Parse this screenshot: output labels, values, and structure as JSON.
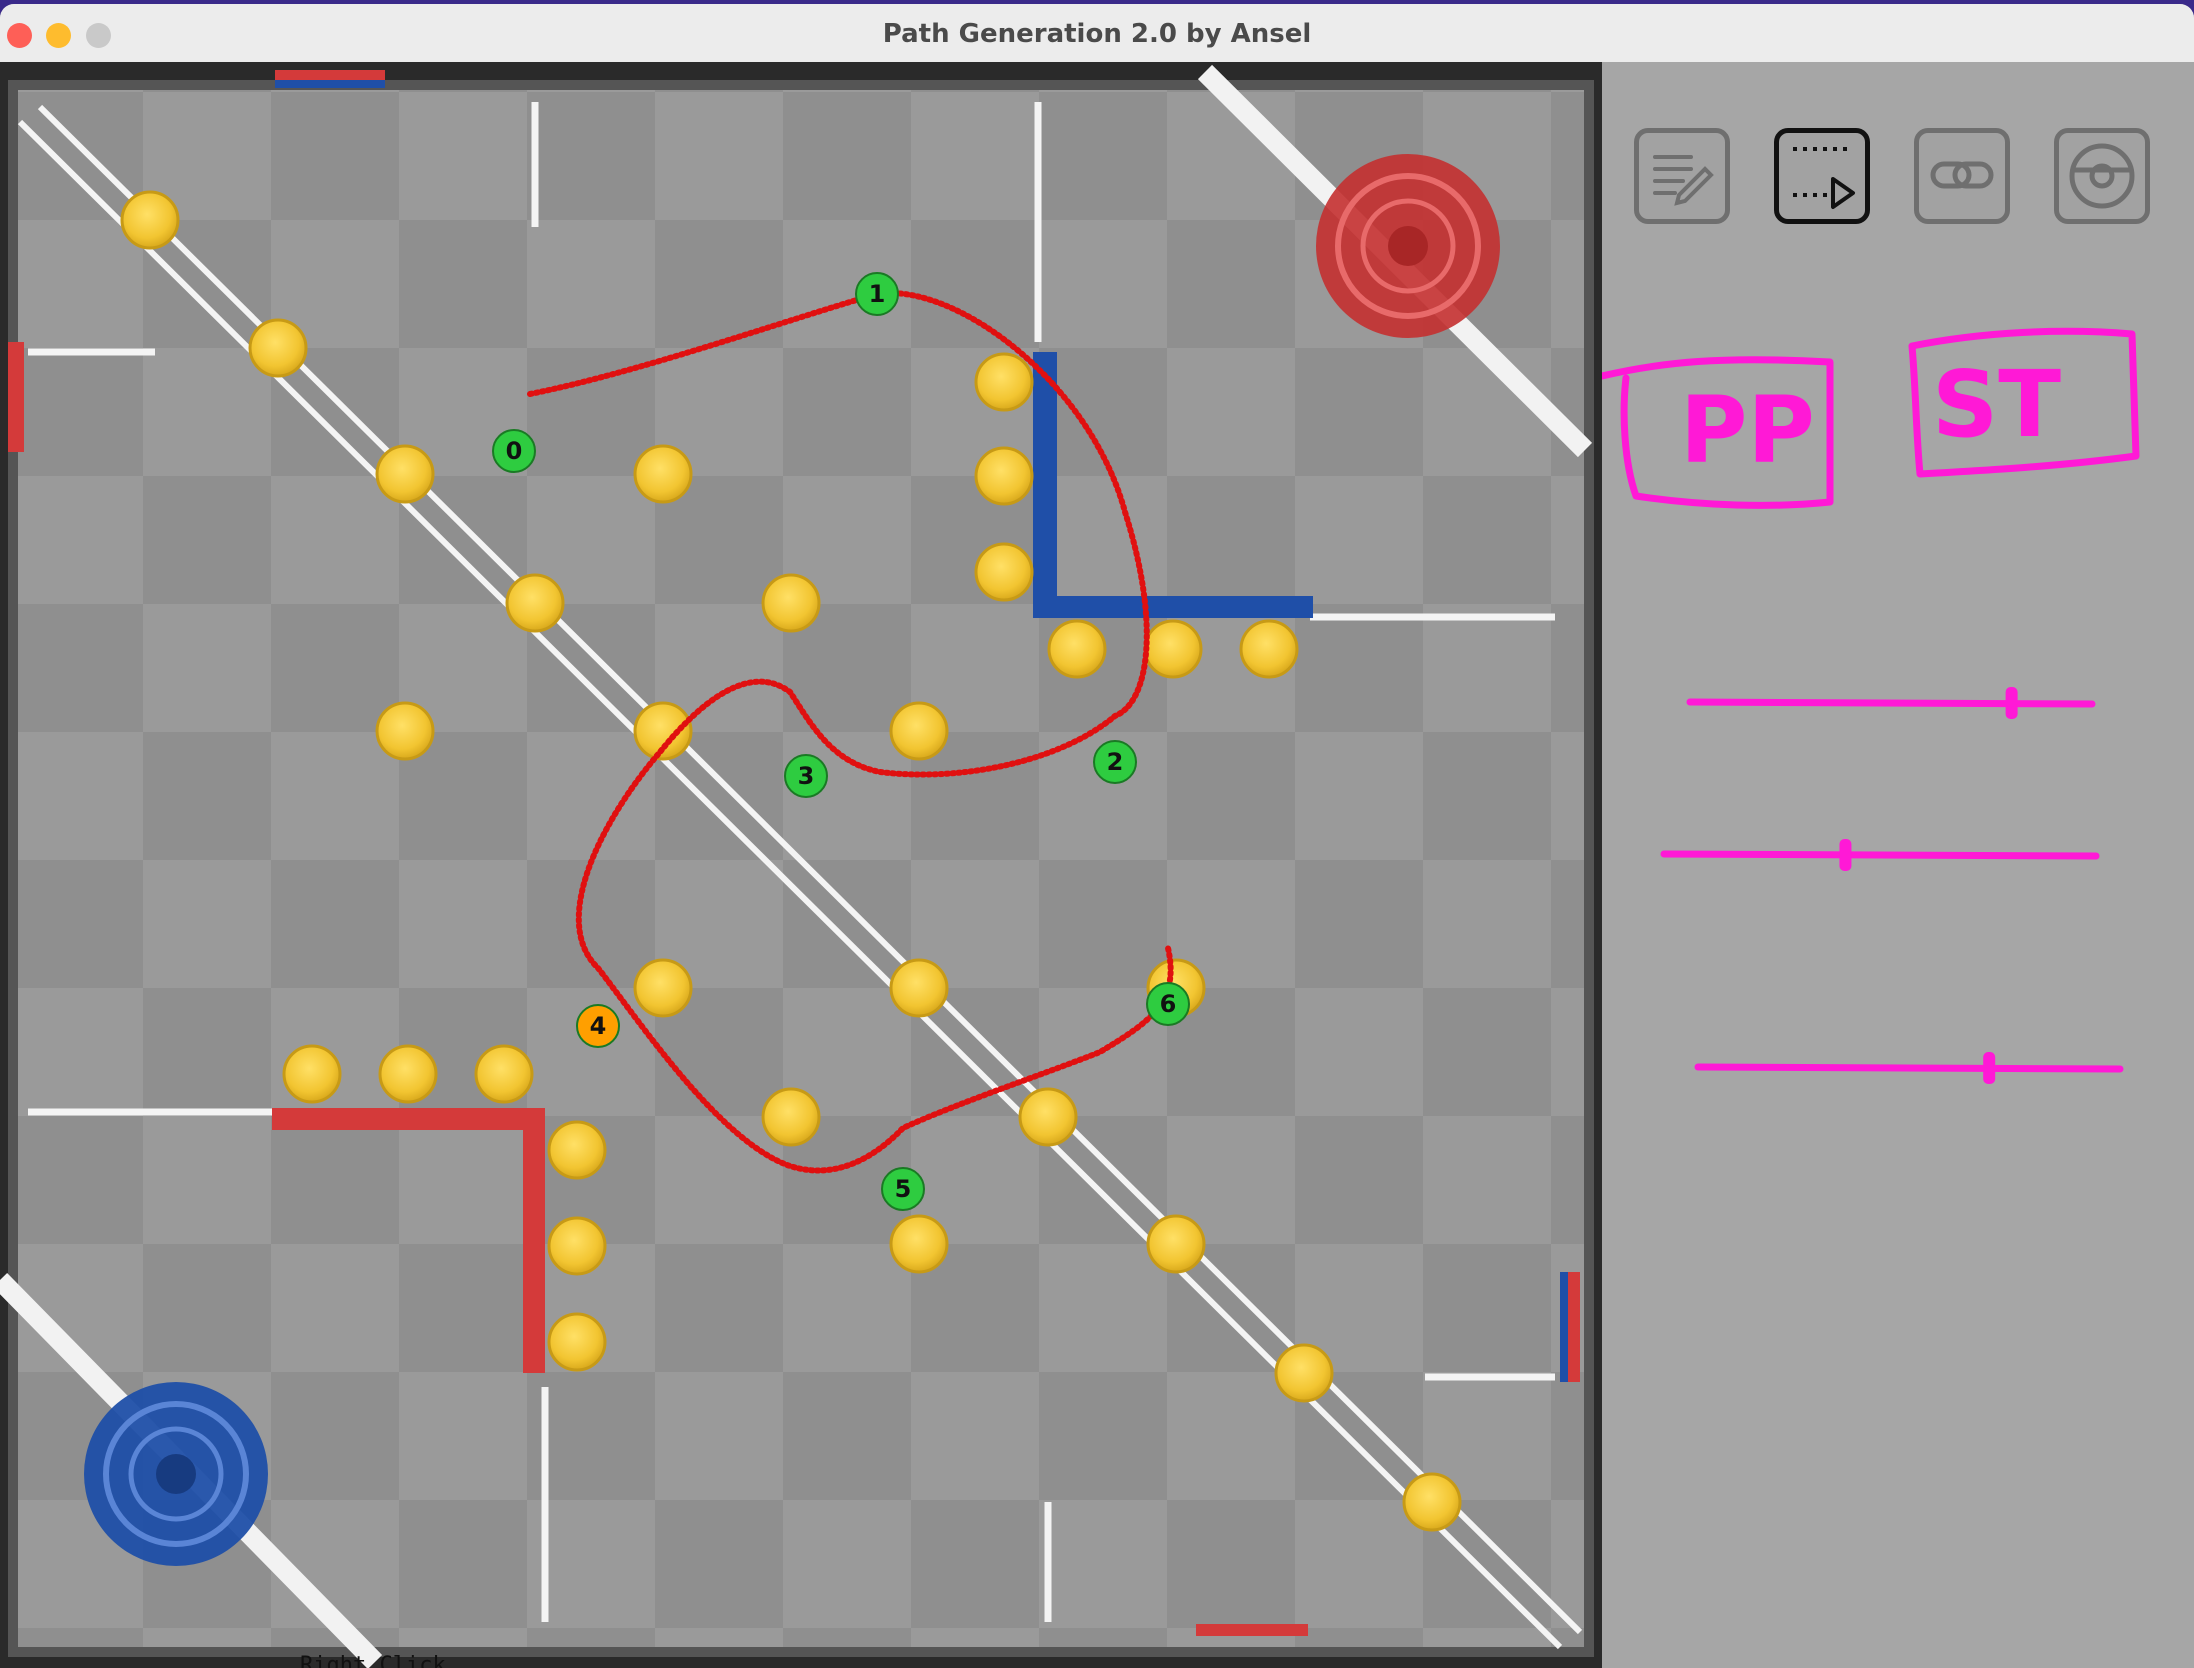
{
  "window": {
    "title": "Path Generation 2.0 by Ansel"
  },
  "toolbar": {
    "buttons": [
      {
        "name": "edit-path-icon",
        "active": false
      },
      {
        "name": "play-animation-icon",
        "active": true
      },
      {
        "name": "link-icon",
        "active": false
      },
      {
        "name": "settings-icon",
        "active": false
      }
    ]
  },
  "handwritten_labels": [
    "PP",
    "ST"
  ],
  "path": {
    "points": [
      {
        "label": "0",
        "color": "#2ecc40"
      },
      {
        "label": "1",
        "color": "#2ecc40"
      },
      {
        "label": "2",
        "color": "#2ecc40"
      },
      {
        "label": "3",
        "color": "#2ecc40"
      },
      {
        "label": "4",
        "color": "#ff9f00"
      },
      {
        "label": "5",
        "color": "#2ecc40"
      },
      {
        "label": "6",
        "color": "#2ecc40"
      }
    ],
    "line_color": "#e01010"
  },
  "sliders": [
    {
      "name": "slider-1",
      "value": 0.8
    },
    {
      "name": "slider-2",
      "value": 0.42
    },
    {
      "name": "slider-3",
      "value": 0.69
    }
  ],
  "colors": {
    "annotation": "#ff19d6",
    "ring": "#f2c531",
    "red_alliance": "#d43a3a",
    "blue_alliance": "#1f4fa8"
  },
  "status": {
    "text": "Right Click"
  }
}
